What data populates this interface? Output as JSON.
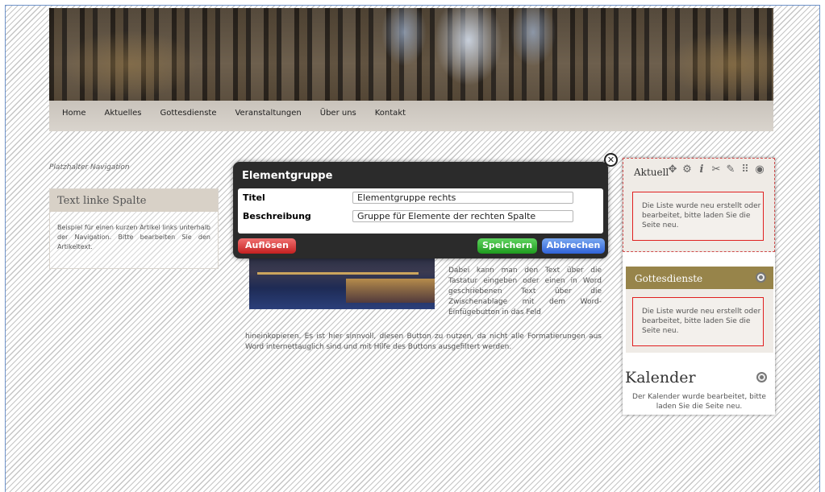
{
  "nav": {
    "items": [
      "Home",
      "Aktuelles",
      "Gottesdienste",
      "Veranstaltungen",
      "Über uns",
      "Kontakt"
    ]
  },
  "left": {
    "placeholder": "Platzhalter Navigation",
    "box_title": "Text linke Spalte",
    "box_text": "Beispiel für einen kurzen Artikel links unterhalb der Navigation. Bitte bearbeiten Sie den Artikeltext."
  },
  "article": {
    "text1": "Dabei kann man den Text über die Tastatur eingeben oder einen in Word geschriebenen Text über die Zwischenablage mit dem Word-Einfügebutton in das Feld",
    "text2": "hineinkopieren. Es ist hier sinnvoll, diesen Button zu nutzen, da nicht alle Formatierungen aus Word internettauglich sind und mit Hilfe des Buttons ausgefiltert werden."
  },
  "dialog": {
    "title": "Elementgruppe",
    "titel_label": "Titel",
    "titel_value": "Elementgruppe rechts",
    "beschreibung_label": "Beschreibung",
    "beschreibung_value": "Gruppe für Elemente der rechten Spalte",
    "dissolve_button": "Auflösen",
    "save_button": "Speichern",
    "cancel_button": "Abbrechen"
  },
  "right": {
    "aktuell_title": "Aktuell",
    "aktuell_message": "Die Liste wurde neu erstellt oder bearbeitet, bitte laden Sie die Seite neu.",
    "gottesdienste_title": "Gottesdienste",
    "gottesdienste_message": "Die Liste wurde neu erstellt oder bearbeitet, bitte laden Sie die Seite neu.",
    "kalender_title": "Kalender",
    "kalender_message": "Der Kalender wurde bearbeitet, bitte laden Sie die Seite neu."
  },
  "icons": [
    "move-icon",
    "settings-icon",
    "info-icon",
    "cut-icon",
    "edit-icon",
    "grid-icon",
    "target-icon",
    "close-icon"
  ]
}
